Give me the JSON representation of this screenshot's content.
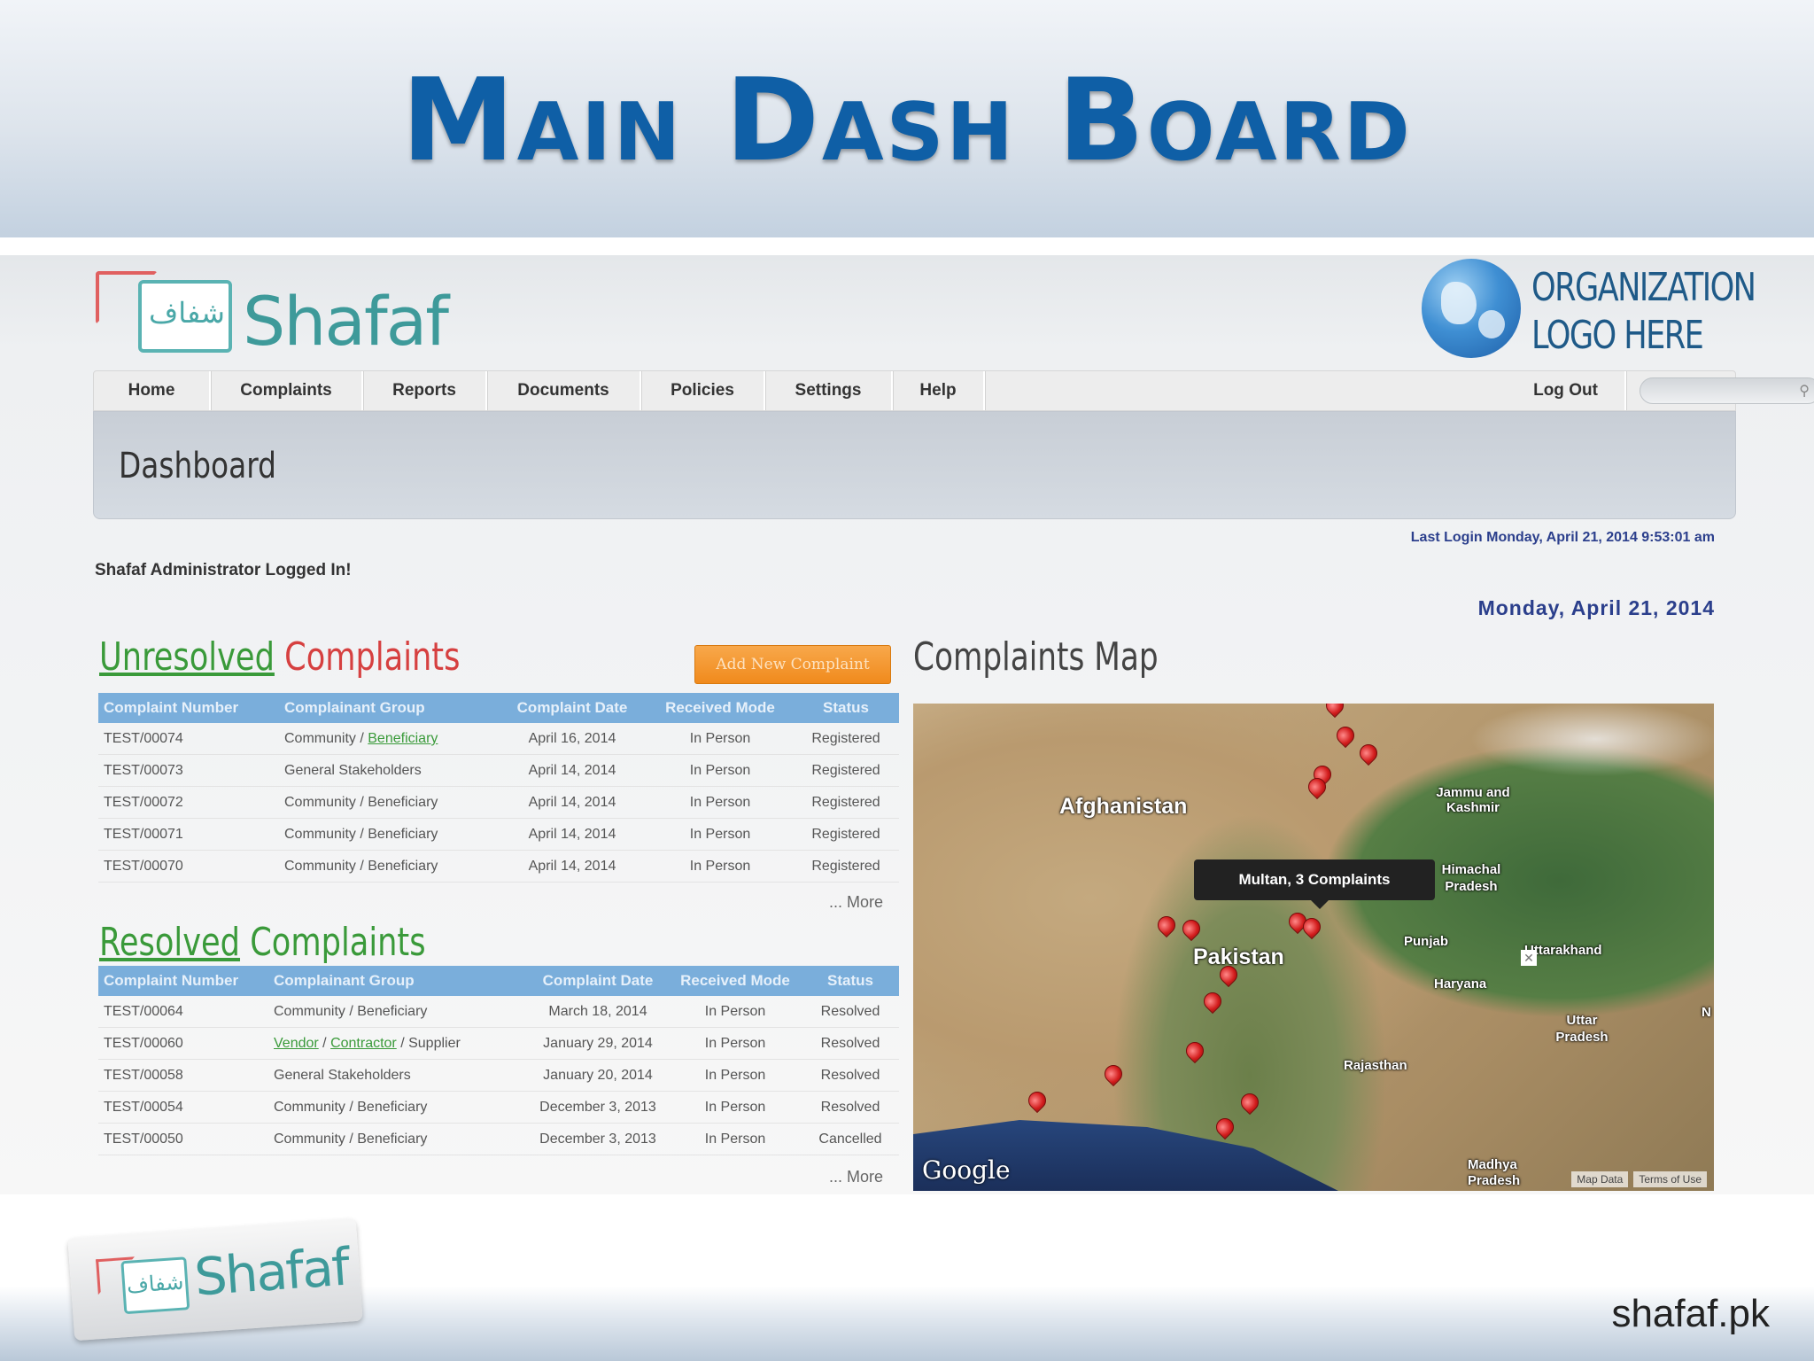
{
  "slide": {
    "title": "Main Dash Board",
    "site": "shafaf.pk"
  },
  "brand": {
    "name": "Shafaf",
    "arabic": "شفاف",
    "org_logo_line1": "ORGANIZATION",
    "org_logo_line2": "LOGO HERE"
  },
  "nav": {
    "items": [
      "Home",
      "Complaints",
      "Reports",
      "Documents",
      "Policies",
      "Settings",
      "Help"
    ],
    "logout": "Log Out",
    "search_placeholder": ""
  },
  "page": {
    "title": "Dashboard",
    "last_login": "Last Login Monday, April 21, 2014 9:53:01 am",
    "logged_in": "Shafaf Administrator Logged In!",
    "today": "Monday, April 21, 2014"
  },
  "unresolved": {
    "title_a": "Unresolved",
    "title_b": "Complaints",
    "add_button": "Add New Complaint",
    "columns": [
      "Complaint Number",
      "Complainant Group",
      "Complaint Date",
      "Received Mode",
      "Status"
    ],
    "rows": [
      {
        "number": "TEST/00074",
        "group_a": "Community / ",
        "group_b": "Beneficiary",
        "date": "April 16, 2014",
        "mode": "In Person",
        "status": "Registered"
      },
      {
        "number": "TEST/00073",
        "group_a": "General Stakeholders",
        "group_b": "",
        "date": "April 14, 2014",
        "mode": "In Person",
        "status": "Registered"
      },
      {
        "number": "TEST/00072",
        "group_a": "Community / Beneficiary",
        "group_b": "",
        "date": "April 14, 2014",
        "mode": "In Person",
        "status": "Registered"
      },
      {
        "number": "TEST/00071",
        "group_a": "Community / Beneficiary",
        "group_b": "",
        "date": "April 14, 2014",
        "mode": "In Person",
        "status": "Registered"
      },
      {
        "number": "TEST/00070",
        "group_a": "Community / Beneficiary",
        "group_b": "",
        "date": "April 14, 2014",
        "mode": "In Person",
        "status": "Registered"
      }
    ],
    "more": "... More"
  },
  "resolved": {
    "title_a": "Resolved",
    "title_b": "Complaints",
    "columns": [
      "Complaint Number",
      "Complainant Group",
      "Complaint Date",
      "Received Mode",
      "Status"
    ],
    "rows": [
      {
        "number": "TEST/00064",
        "group_a": "Community / Beneficiary",
        "group_link1": "",
        "group_sep": "",
        "group_link2": "",
        "group_tail": "",
        "date": "March 18, 2014",
        "mode": "In Person",
        "status": "Resolved"
      },
      {
        "number": "TEST/00060",
        "group_a": "",
        "group_link1": "Vendor",
        "group_sep": " / ",
        "group_link2": "Contractor",
        "group_tail": " / Supplier",
        "date": "January 29, 2014",
        "mode": "In Person",
        "status": "Resolved"
      },
      {
        "number": "TEST/00058",
        "group_a": "General Stakeholders",
        "group_link1": "",
        "group_sep": "",
        "group_link2": "",
        "group_tail": "",
        "date": "January 20, 2014",
        "mode": "In Person",
        "status": "Resolved"
      },
      {
        "number": "TEST/00054",
        "group_a": "Community / Beneficiary",
        "group_link1": "",
        "group_sep": "",
        "group_link2": "",
        "group_tail": "",
        "date": "December 3, 2013",
        "mode": "In Person",
        "status": "Resolved"
      },
      {
        "number": "TEST/00050",
        "group_a": "Community / Beneficiary",
        "group_link1": "",
        "group_sep": "",
        "group_link2": "",
        "group_tail": "",
        "date": "December 3, 2013",
        "mode": "In Person",
        "status": "Cancelled"
      }
    ],
    "more": "... More"
  },
  "map": {
    "title": "Complaints Map",
    "tooltip": "Multan, 3 Complaints",
    "labels": {
      "afghanistan": "Afghanistan",
      "pakistan": "Pakistan",
      "jammu": "Jammu and Kashmir",
      "himachal": "Himachal Pradesh",
      "punjab": "Punjab",
      "uttarakhand": "Uttarakhand",
      "haryana": "Haryana",
      "uttar": "Uttar Pradesh",
      "rajasthan": "Rajasthan",
      "madhya": "Madhya Pradesh",
      "n": "N"
    },
    "google": "Google",
    "map_data": "Map Data",
    "terms": "Terms of Use"
  }
}
